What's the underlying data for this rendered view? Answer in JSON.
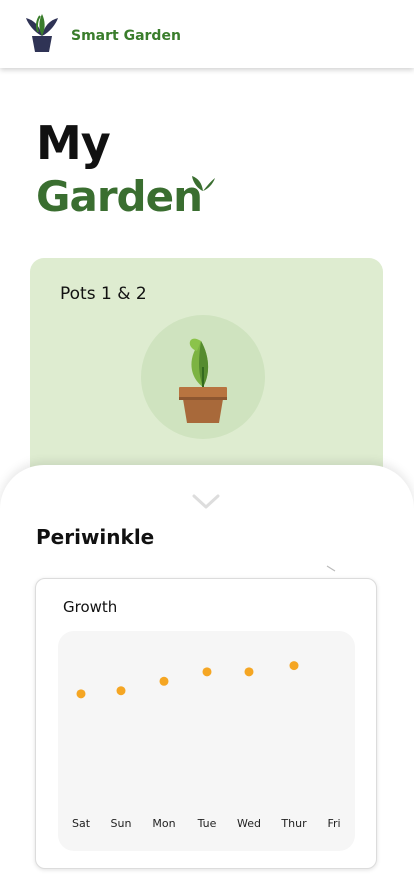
{
  "header": {
    "app_title": "Smart Garden",
    "logo_icon": "plant-pot-logo-icon"
  },
  "page": {
    "title_line1": "My",
    "title_line2": "Garden",
    "title_icon": "sprout-icon"
  },
  "pot_card": {
    "title": "Pots 1 & 2",
    "icon": "potted-plant-icon",
    "background": "#deecd0"
  },
  "sheet": {
    "handle_icon": "chevron-down-icon",
    "plant_name": "Periwinkle",
    "growth_card": {
      "title": "Growth"
    }
  },
  "colors": {
    "brand_green": "#3a7d2c",
    "point_orange": "#f5a623"
  },
  "chart_data": {
    "type": "scatter",
    "title": "Growth",
    "categories": [
      "Sat",
      "Sun",
      "Mon",
      "Tue",
      "Wed",
      "Thur",
      "Fri"
    ],
    "values": [
      5.0,
      5.1,
      5.4,
      5.7,
      5.7,
      5.9,
      null
    ],
    "ylim": [
      0,
      7
    ],
    "grid": false,
    "xlabel": "",
    "ylabel": ""
  }
}
